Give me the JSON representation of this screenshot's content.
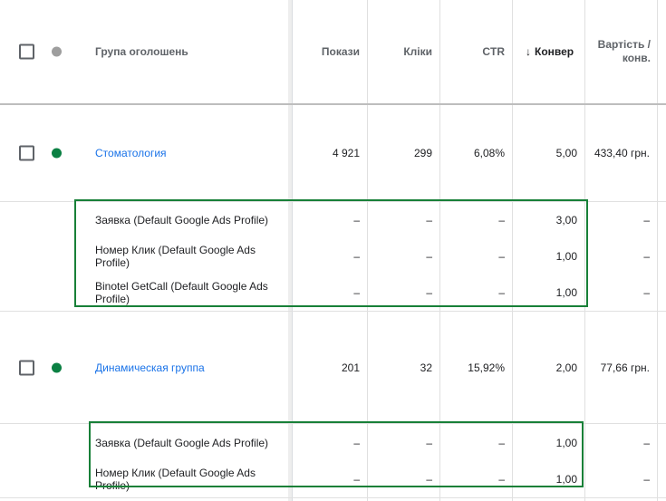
{
  "header": {
    "ad_group": "Група оголошень",
    "impressions": "Покази",
    "clicks": "Кліки",
    "ctr": "CTR",
    "conversions": "Конвер",
    "cost_per_conv_line1": "Вартість /",
    "cost_per_conv_line2": "конв.",
    "sort_icon": "↓"
  },
  "groups": [
    {
      "name": "Стоматология",
      "impressions": "4 921",
      "clicks": "299",
      "ctr": "6,08%",
      "conversions": "5,00",
      "cost_per_conv": "433,40 грн.",
      "status_color": "#0b8043",
      "actions": [
        {
          "name": "Заявка (Default Google Ads Profile)",
          "impressions": "–",
          "clicks": "–",
          "ctr": "–",
          "conversions": "3,00",
          "cost_per_conv": "–"
        },
        {
          "name": "Номер Клик (Default Google Ads Profile)",
          "impressions": "–",
          "clicks": "–",
          "ctr": "–",
          "conversions": "1,00",
          "cost_per_conv": "–"
        },
        {
          "name": "Binotel GetCall (Default Google Ads Profile)",
          "impressions": "–",
          "clicks": "–",
          "ctr": "–",
          "conversions": "1,00",
          "cost_per_conv": "–"
        }
      ]
    },
    {
      "name": "Динамическая группа",
      "impressions": "201",
      "clicks": "32",
      "ctr": "15,92%",
      "conversions": "2,00",
      "cost_per_conv": "77,66 грн.",
      "status_color": "#0b8043",
      "actions": [
        {
          "name": "Заявка (Default Google Ads Profile)",
          "impressions": "–",
          "clicks": "–",
          "ctr": "–",
          "conversions": "1,00",
          "cost_per_conv": "–"
        },
        {
          "name": "Номер Клик (Default Google Ads Profile)",
          "impressions": "–",
          "clicks": "–",
          "ctr": "–",
          "conversions": "1,00",
          "cost_per_conv": "–"
        }
      ]
    }
  ],
  "highlight_color": "#188038"
}
